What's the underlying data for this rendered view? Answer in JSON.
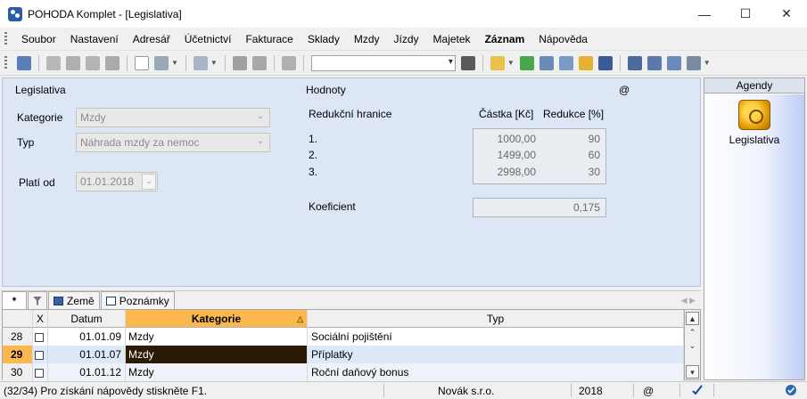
{
  "window": {
    "title": "POHODA Komplet - [Legislativa]"
  },
  "menu": [
    "Soubor",
    "Nastavení",
    "Adresář",
    "Účetnictví",
    "Fakturace",
    "Sklady",
    "Mzdy",
    "Jízdy",
    "Majetek",
    "Záznam",
    "Nápověda"
  ],
  "menu_bold": "Záznam",
  "form": {
    "section_left": "Legislativa",
    "kategorie_label": "Kategorie",
    "kategorie_value": "Mzdy",
    "typ_label": "Typ",
    "typ_value": "Náhrada mzdy za nemoc",
    "plati_od_label": "Platí od",
    "plati_od_value": "01.01.2018",
    "section_right": "Hodnoty",
    "at_sign": "@",
    "reduction_header": "Redukční hranice",
    "amount_header": "Částka [Kč]",
    "reduction_pct_header": "Redukce [%]",
    "rows": [
      {
        "label": "1.",
        "amount": "1000,00",
        "pct": "90"
      },
      {
        "label": "2.",
        "amount": "1499,00",
        "pct": "60"
      },
      {
        "label": "3.",
        "amount": "2998,00",
        "pct": "30"
      }
    ],
    "koef_label": "Koeficient",
    "koef_value": "0,175"
  },
  "agendy": {
    "title": "Agendy",
    "item_label": "Legislativa"
  },
  "tabs": {
    "first": "*",
    "zeme": "Země",
    "poznamky": "Poznámky"
  },
  "grid": {
    "headers": {
      "x": "X",
      "datum": "Datum",
      "kategorie": "Kategorie",
      "typ": "Typ"
    },
    "rows": [
      {
        "num": "28",
        "datum": "01.01.09",
        "kategorie": "Mzdy",
        "typ": "Sociální pojištění"
      },
      {
        "num": "29",
        "datum": "01.01.07",
        "kategorie": "Mzdy",
        "typ": "Příplatky"
      },
      {
        "num": "30",
        "datum": "01.01.12",
        "kategorie": "Mzdy",
        "typ": "Roční daňový bonus"
      }
    ]
  },
  "status": {
    "hint": "(32/34) Pro získání nápovědy stiskněte F1.",
    "company": "Novák s.r.o.",
    "year": "2018",
    "at_sign": "@"
  },
  "colors": {
    "form_bg": "#dce6f4",
    "sorted_header": "#fbb84e",
    "dark_cell": "#2a1a06"
  }
}
